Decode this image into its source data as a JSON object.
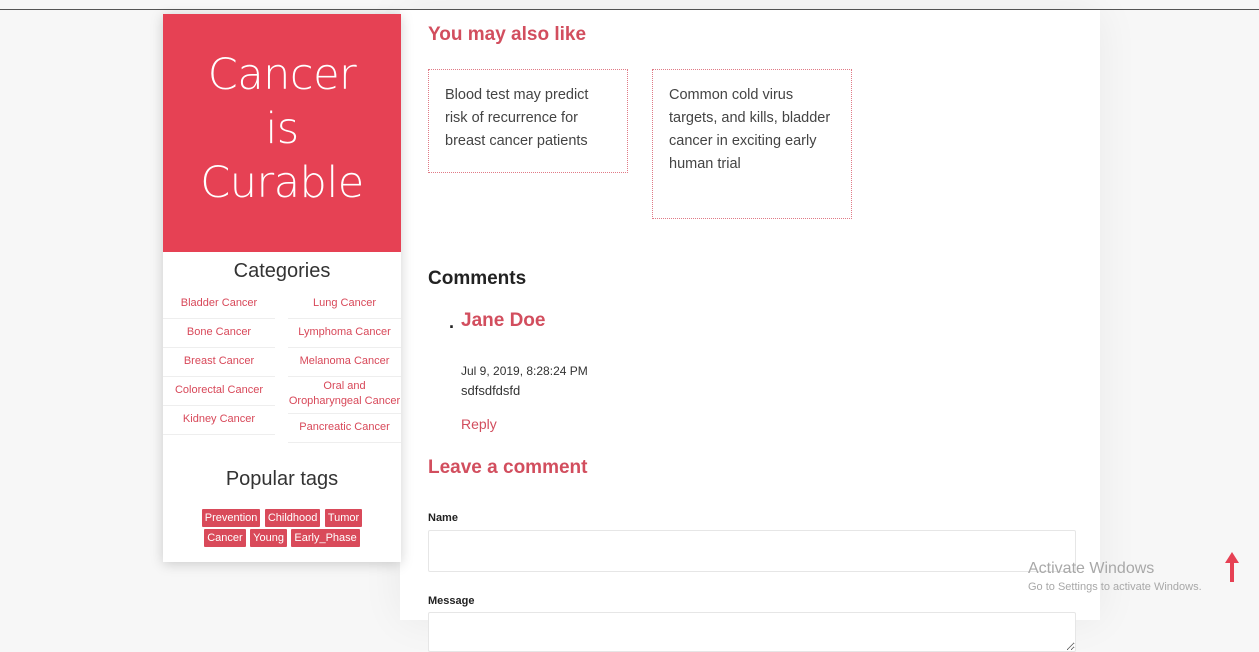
{
  "sidebar": {
    "hero": {
      "line1": "Cancer",
      "line2": "is",
      "line3": "Curable"
    },
    "categories_title": "Categories",
    "categories_left": [
      "Bladder Cancer",
      "Bone Cancer",
      "Breast Cancer",
      "Colorectal Cancer",
      "Kidney Cancer"
    ],
    "categories_right": [
      "Lung Cancer",
      "Lymphoma Cancer",
      "Melanoma Cancer",
      "Oral and Oropharyngeal Cancer",
      "Pancreatic Cancer"
    ],
    "tags_title": "Popular tags",
    "tags": [
      "Prevention",
      "Childhood",
      "Tumor",
      "Cancer",
      "Young",
      "Early_Phase"
    ]
  },
  "related": {
    "title": "You may also like",
    "cards": [
      "Blood test may predict risk of recurrence for breast cancer patients",
      "Common cold virus targets, and kills, bladder cancer in exciting early human trial"
    ]
  },
  "comments": {
    "title": "Comments",
    "items": [
      {
        "bullet": ".",
        "author": "Jane Doe",
        "date": "Jul 9, 2019, 8:28:24 PM",
        "body": "sdfsdfdsfd",
        "reply": "Reply"
      }
    ]
  },
  "leave_comment": {
    "title": "Leave a comment",
    "name_label": "Name",
    "message_label": "Message"
  },
  "windows_watermark": {
    "line1": "Activate Windows",
    "line2": "Go to Settings to activate Windows."
  },
  "colors": {
    "accent": "#e64154",
    "link": "#d24e5e"
  },
  "icons": {
    "scroll_top": "arrow-up-icon"
  }
}
